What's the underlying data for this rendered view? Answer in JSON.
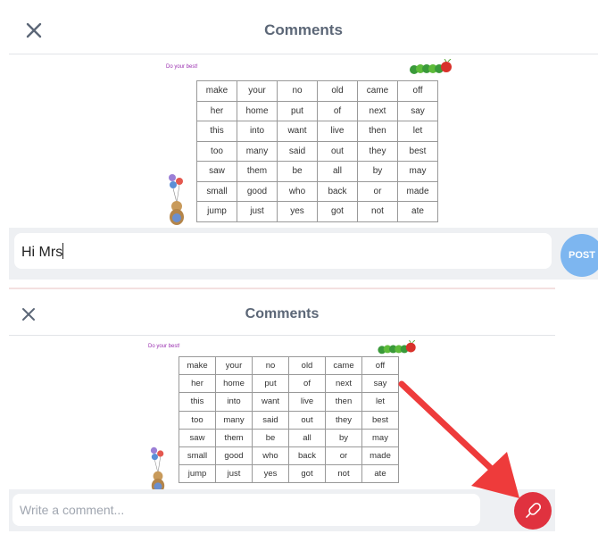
{
  "top": {
    "header": {
      "title": "Comments"
    },
    "sheet": {
      "motto": "Do your best!",
      "words": [
        [
          "make",
          "your",
          "no",
          "old",
          "came",
          "off"
        ],
        [
          "her",
          "home",
          "put",
          "of",
          "next",
          "say"
        ],
        [
          "this",
          "into",
          "want",
          "live",
          "then",
          "let"
        ],
        [
          "too",
          "many",
          "said",
          "out",
          "they",
          "best"
        ],
        [
          "saw",
          "them",
          "be",
          "all",
          "by",
          "may"
        ],
        [
          "small",
          "good",
          "who",
          "back",
          "or",
          "made"
        ],
        [
          "jump",
          "just",
          "yes",
          "got",
          "not",
          "ate"
        ]
      ]
    },
    "comment_input": {
      "value": "Hi Mrs"
    },
    "post_label": "POST"
  },
  "bottom": {
    "header": {
      "title": "Comments"
    },
    "sheet": {
      "motto": "Do your best!",
      "words": [
        [
          "make",
          "your",
          "no",
          "old",
          "came",
          "off"
        ],
        [
          "her",
          "home",
          "put",
          "of",
          "next",
          "say"
        ],
        [
          "this",
          "into",
          "want",
          "live",
          "then",
          "let"
        ],
        [
          "too",
          "many",
          "said",
          "out",
          "they",
          "best"
        ],
        [
          "saw",
          "them",
          "be",
          "all",
          "by",
          "may"
        ],
        [
          "small",
          "good",
          "who",
          "back",
          "or",
          "made"
        ],
        [
          "jump",
          "just",
          "yes",
          "got",
          "not",
          "ate"
        ]
      ]
    },
    "comment_input": {
      "placeholder": "Write a comment..."
    },
    "mic_icon": "microphone-icon"
  },
  "colors": {
    "post_button": "#7db6f0",
    "mic_button": "#e0323f",
    "annotation_arrow": "#ee3b3b",
    "title": "#5c6777"
  }
}
